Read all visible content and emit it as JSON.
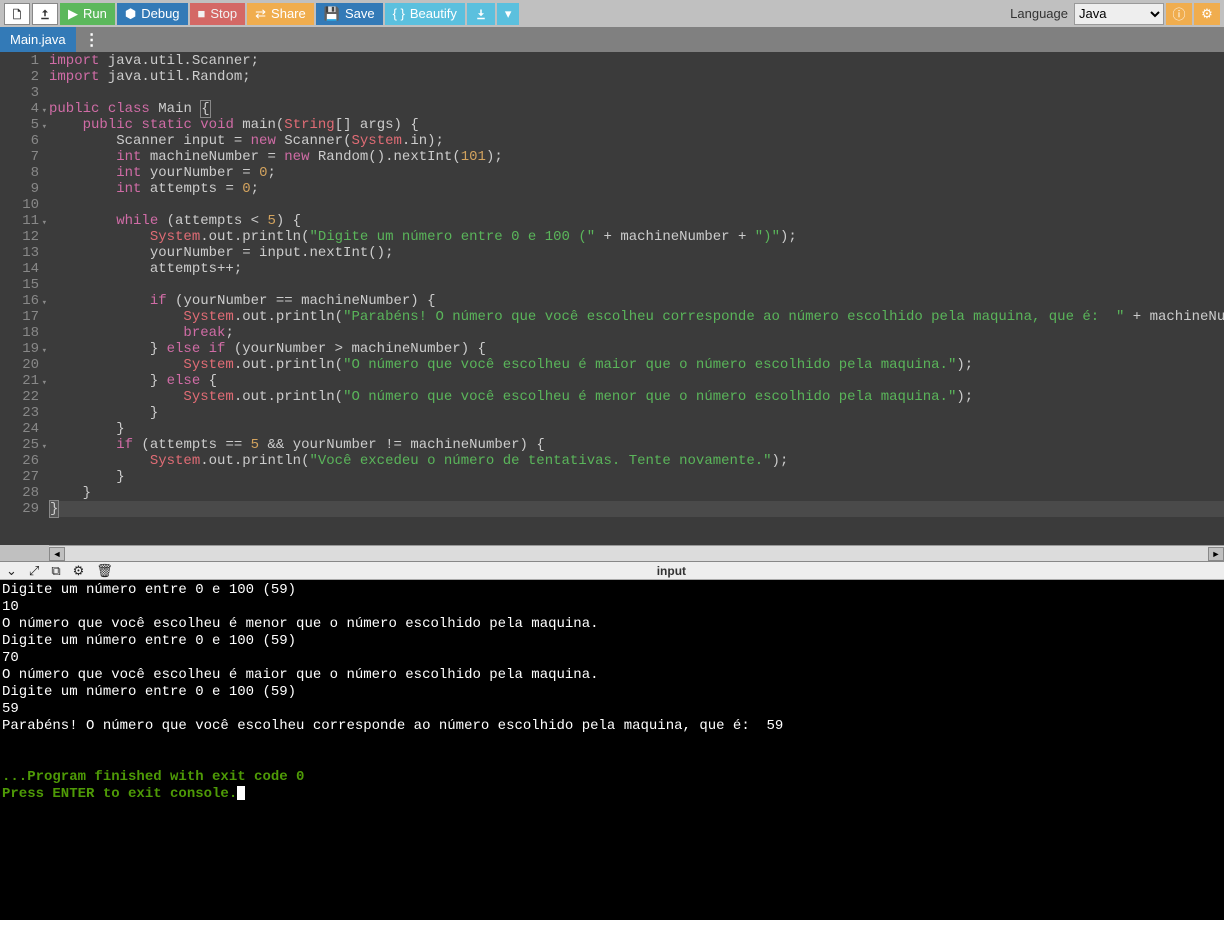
{
  "toolbar": {
    "run": "Run",
    "debug": "Debug",
    "stop": "Stop",
    "share": "Share",
    "save": "Save",
    "beautify": "Beautify",
    "language_label": "Language",
    "language_value": "Java"
  },
  "tabs": {
    "main": "Main.java"
  },
  "code": {
    "lines": [
      {
        "n": 1,
        "fold": false,
        "html": "<span class='kw'>import</span> java.util.Scanner;"
      },
      {
        "n": 2,
        "fold": false,
        "html": "<span class='kw'>import</span> java.util.Random;"
      },
      {
        "n": 3,
        "fold": false,
        "html": ""
      },
      {
        "n": 4,
        "fold": true,
        "html": "<span class='kw'>public</span> <span class='kw'>class</span> <span class='id'>Main</span> <span style='border:1px solid #888'>{</span>"
      },
      {
        "n": 5,
        "fold": true,
        "html": "    <span class='kw'>public</span> <span class='kw'>static</span> <span class='kw'>void</span> main(<span class='cls'>String</span>[] args) {"
      },
      {
        "n": 6,
        "fold": false,
        "html": "        Scanner input <span class='op'>=</span> <span class='kw'>new</span> Scanner(<span class='sys'>System</span>.in);"
      },
      {
        "n": 7,
        "fold": false,
        "html": "        <span class='kw'>int</span> machineNumber <span class='op'>=</span> <span class='kw'>new</span> Random().nextInt(<span class='num'>101</span>);"
      },
      {
        "n": 8,
        "fold": false,
        "html": "        <span class='kw'>int</span> yourNumber <span class='op'>=</span> <span class='num'>0</span>;"
      },
      {
        "n": 9,
        "fold": false,
        "html": "        <span class='kw'>int</span> attempts <span class='op'>=</span> <span class='num'>0</span>;"
      },
      {
        "n": 10,
        "fold": false,
        "html": ""
      },
      {
        "n": 11,
        "fold": true,
        "html": "        <span class='kw'>while</span> (attempts <span class='op'>&lt;</span> <span class='num'>5</span>) {"
      },
      {
        "n": 12,
        "fold": false,
        "html": "            <span class='sys'>System</span>.out.println(<span class='str'>\"Digite um número entre 0 e 100 (\"</span> <span class='op'>+</span> machineNumber <span class='op'>+</span> <span class='str'>\")\"</span>);"
      },
      {
        "n": 13,
        "fold": false,
        "html": "            yourNumber <span class='op'>=</span> input.nextInt();"
      },
      {
        "n": 14,
        "fold": false,
        "html": "            attempts<span class='op'>++</span>;"
      },
      {
        "n": 15,
        "fold": false,
        "html": ""
      },
      {
        "n": 16,
        "fold": true,
        "html": "            <span class='kw'>if</span> (yourNumber <span class='op'>==</span> machineNumber) {"
      },
      {
        "n": 17,
        "fold": false,
        "html": "                <span class='sys'>System</span>.out.println(<span class='str'>\"Parabéns! O número que você escolheu corresponde ao número escolhido pela maquina, que é:  \"</span> <span class='op'>+</span> machineNumber);"
      },
      {
        "n": 18,
        "fold": false,
        "html": "                <span class='kw'>break</span>;"
      },
      {
        "n": 19,
        "fold": true,
        "html": "            } <span class='kw'>else</span> <span class='kw'>if</span> (yourNumber <span class='op'>&gt;</span> machineNumber) {"
      },
      {
        "n": 20,
        "fold": false,
        "html": "                <span class='sys'>System</span>.out.println(<span class='str'>\"O número que você escolheu é maior que o número escolhido pela maquina.\"</span>);"
      },
      {
        "n": 21,
        "fold": true,
        "html": "            } <span class='kw'>else</span> {"
      },
      {
        "n": 22,
        "fold": false,
        "html": "                <span class='sys'>System</span>.out.println(<span class='str'>\"O número que você escolheu é menor que o número escolhido pela maquina.\"</span>);"
      },
      {
        "n": 23,
        "fold": false,
        "html": "            }"
      },
      {
        "n": 24,
        "fold": false,
        "html": "        }"
      },
      {
        "n": 25,
        "fold": true,
        "html": "        <span class='kw'>if</span> (attempts <span class='op'>==</span> <span class='num'>5</span> <span class='op'>&amp;&amp;</span> yourNumber <span class='op'>!=</span> machineNumber) {"
      },
      {
        "n": 26,
        "fold": false,
        "html": "            <span class='sys'>System</span>.out.println(<span class='str'>\"Você excedeu o número de tentativas. Tente novamente.\"</span>);"
      },
      {
        "n": 27,
        "fold": false,
        "html": "        }"
      },
      {
        "n": 28,
        "fold": false,
        "html": "    }"
      },
      {
        "n": 29,
        "fold": false,
        "hl": true,
        "html": "<span style='background:#555;border:1px solid #888'>}</span>"
      }
    ]
  },
  "console": {
    "title": "input",
    "output": [
      "Digite um número entre 0 e 100 (59)",
      "10",
      "O número que você escolheu é menor que o número escolhido pela maquina.",
      "Digite um número entre 0 e 100 (59)",
      "70",
      "O número que você escolheu é maior que o número escolhido pela maquina.",
      "Digite um número entre 0 e 100 (59)",
      "59",
      "Parabéns! O número que você escolheu corresponde ao número escolhido pela maquina, que é:  59"
    ],
    "status1": "...Program finished with exit code 0",
    "status2": "Press ENTER to exit console."
  }
}
